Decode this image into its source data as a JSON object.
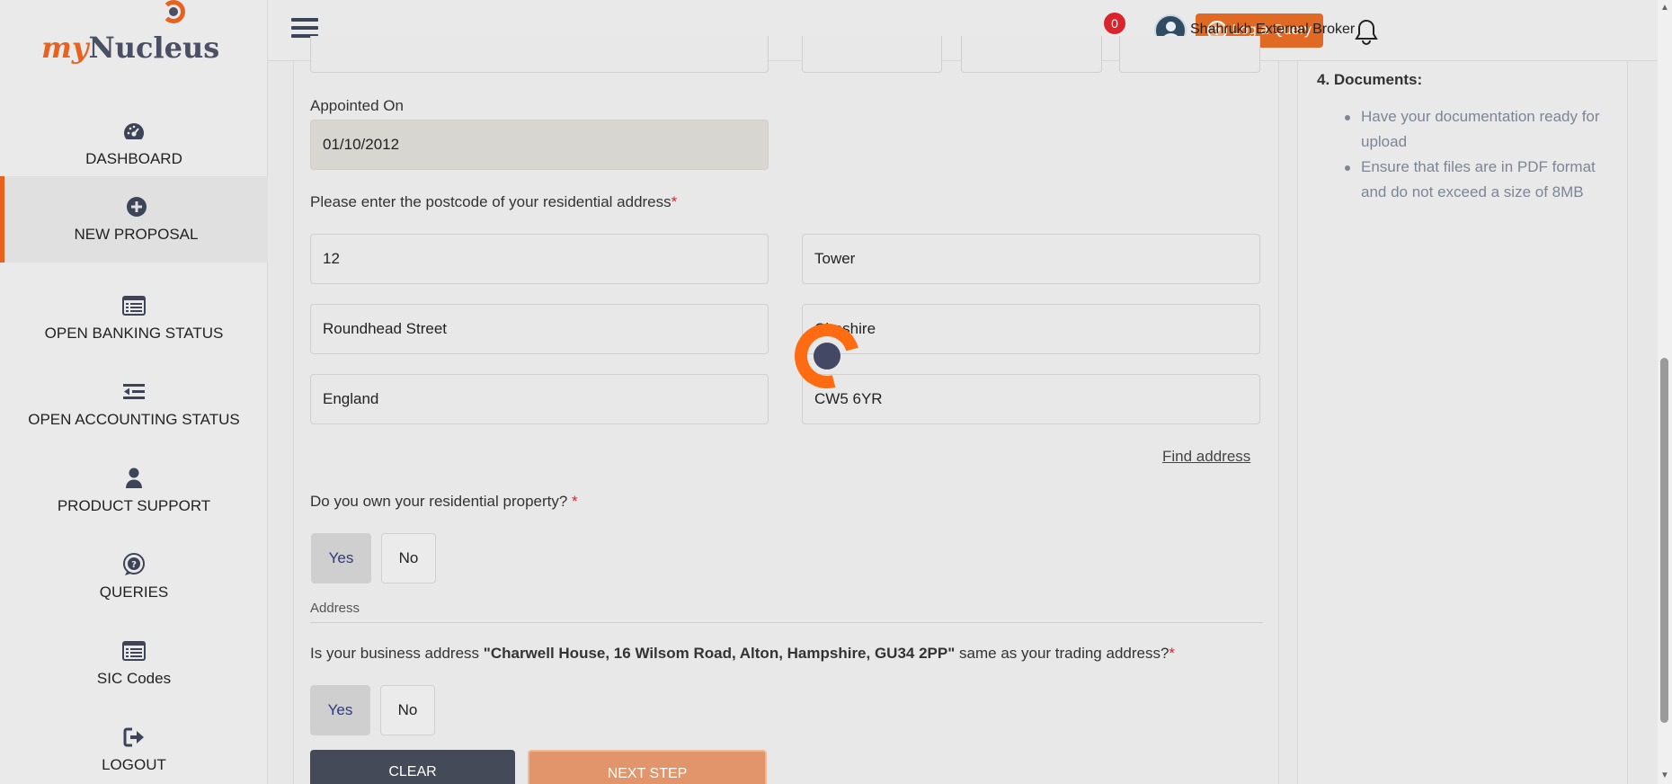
{
  "app": {
    "logo_my": "my",
    "logo_nucleus": "Nucleus"
  },
  "sidebar": {
    "items": [
      {
        "label": "DASHBOARD",
        "icon": "dashboard-gauge-icon"
      },
      {
        "label": "NEW PROPOSAL",
        "icon": "plus-circle-icon",
        "active": true
      },
      {
        "label": "OPEN BANKING STATUS",
        "icon": "list-card-icon"
      },
      {
        "label": "OPEN ACCOUNTING STATUS",
        "icon": "indent-list-icon"
      },
      {
        "label": "PRODUCT SUPPORT",
        "icon": "user-icon"
      },
      {
        "label": "QUERIES",
        "icon": "question-bubble-icon"
      },
      {
        "label": "SIC Codes",
        "icon": "list-card-icon"
      },
      {
        "label": "LOGOUT",
        "icon": "sign-out-icon"
      }
    ]
  },
  "topbar": {
    "log_query_label": "Log a Query",
    "notification_count": "0",
    "user_name": "Shahrukh External Broker"
  },
  "form": {
    "appointed_on_label": "Appointed On",
    "appointed_on_value": "01/10/2012",
    "postcode_label": "Please enter the postcode of your residential address",
    "address_fields": [
      "12",
      "Tower",
      "Roundhead Street",
      "Cheshire",
      "England",
      "CW5 6YR"
    ],
    "find_address_label": "Find address",
    "own_property_question": "Do you own your residential property? ",
    "own_property_options": [
      "Yes",
      "No"
    ],
    "own_property_selected": "Yes",
    "address_section_title": "Address",
    "business_address_prefix": "Is your business address ",
    "business_address_value": "\"Charwell House, 16 Wilsom Road, Alton, Hampshire, GU34 2PP\"",
    "business_address_suffix": " same as your trading address?",
    "business_address_options": [
      "Yes",
      "No"
    ],
    "business_address_selected": "Yes",
    "required_marker": "*",
    "clear_label": "CLEAR",
    "next_step_label": "NEXT STEP"
  },
  "info": {
    "title": "4. Documents:",
    "items": [
      "Have your documentation ready for upload",
      "Ensure that files are in PDF format and do not exceed a size of 8MB"
    ]
  },
  "colors": {
    "accent": "#e8621e",
    "dark": "#454a58",
    "required": "#d9232d",
    "info_text": "#7d8594"
  }
}
